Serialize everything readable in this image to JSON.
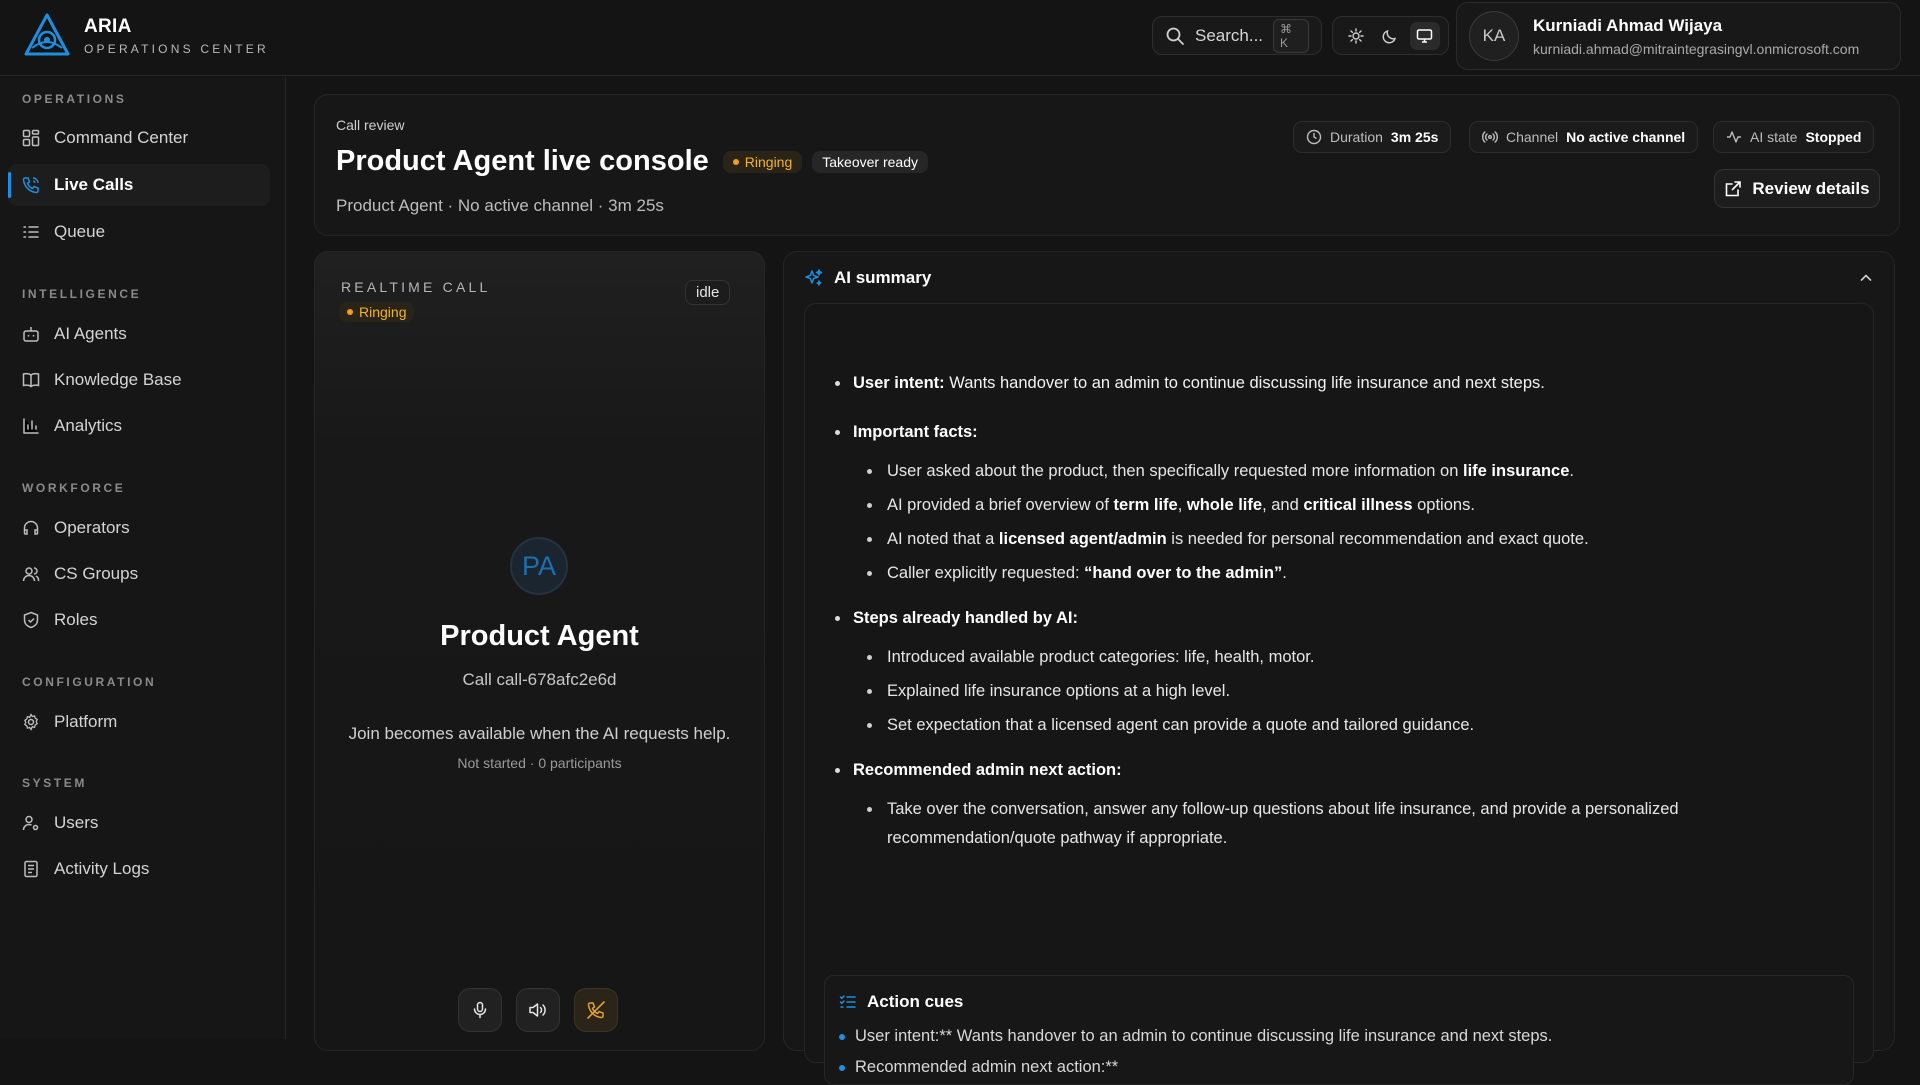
{
  "brand": {
    "title": "ARIA",
    "subtitle": "OPERATIONS CENTER",
    "accent": "#1d8fe0"
  },
  "search": {
    "label": "Search...",
    "shortcut": "⌘ K"
  },
  "theme_toggle": {
    "options": [
      "sun-icon",
      "moon-icon",
      "monitor-icon"
    ],
    "selected": "monitor-icon"
  },
  "user": {
    "initials": "KA",
    "name": "Kurniadi Ahmad Wijaya",
    "email": "kurniadi.ahmad@mitraintegrasingvl.onmicrosoft.com"
  },
  "sidebar": {
    "operations": {
      "title": "OPERATIONS",
      "items": [
        {
          "label": "Command Center",
          "icon": "grid-icon"
        },
        {
          "label": "Live Calls",
          "icon": "phone-icon",
          "active": true
        },
        {
          "label": "Queue",
          "icon": "list-icon"
        }
      ]
    },
    "intelligence": {
      "title": "INTELLIGENCE",
      "items": [
        {
          "label": "AI Agents",
          "icon": "bot-icon"
        },
        {
          "label": "Knowledge Base",
          "icon": "book-icon"
        },
        {
          "label": "Analytics",
          "icon": "bar-chart-icon"
        }
      ]
    },
    "workforce": {
      "title": "WORKFORCE",
      "items": [
        {
          "label": "Operators",
          "icon": "headset-icon"
        },
        {
          "label": "CS Groups",
          "icon": "users-icon"
        },
        {
          "label": "Roles",
          "icon": "shield-icon"
        }
      ]
    },
    "configuration": {
      "title": "CONFIGURATION",
      "items": [
        {
          "label": "Platform",
          "icon": "gear-icon"
        }
      ]
    },
    "system": {
      "title": "SYSTEM",
      "items": [
        {
          "label": "Users",
          "icon": "user-cog-icon"
        },
        {
          "label": "Activity Logs",
          "icon": "log-icon"
        }
      ]
    }
  },
  "header": {
    "eyebrow": "Call review",
    "title": "Product Agent live console",
    "status": "Ringing",
    "badge": "Takeover ready",
    "meta": "Product Agent · No active channel · 3m 25s",
    "duration": {
      "label": "Duration",
      "value": "3m 25s"
    },
    "channel": {
      "label": "Channel",
      "value": "No active channel"
    },
    "ai_state": {
      "label": "AI state",
      "value": "Stopped"
    },
    "review_button": "Review details"
  },
  "call_panel": {
    "title": "REALTIME CALL",
    "status": "Ringing",
    "idle": "idle",
    "initials": "PA",
    "agent_name": "Product Agent",
    "call_id": "Call call-678afc2e6d",
    "join_text": "Join becomes available when the AI requests help.",
    "participants": "Not started · 0 participants",
    "controls": [
      "microphone-icon",
      "speaker-icon",
      "phone-off-icon"
    ]
  },
  "summary": {
    "title": "AI summary",
    "user_intent": {
      "label": "User intent:",
      "text": " Wants handover to an admin to continue discussing life insurance and next steps."
    },
    "facts": {
      "label": "Important facts:",
      "f1": {
        "pre": "User asked about the product, then specifically requested more information on ",
        "b1": "life insurance",
        "post": "."
      },
      "f2": {
        "pre": "AI provided a brief overview of ",
        "b1": "term life",
        "mid1": ", ",
        "b2": "whole life",
        "mid2": ", and ",
        "b3": "critical illness",
        "post": " options."
      },
      "f3": {
        "pre": "AI noted that a ",
        "b1": "licensed agent/admin",
        "post": " is needed for personal recommendation and exact quote."
      },
      "f4": {
        "pre": "Caller explicitly requested: ",
        "b1": "“hand over to the admin”",
        "post": "."
      }
    },
    "handled": {
      "label": "Steps already handled by AI:",
      "items": [
        "Introduced available product categories: life, health, motor.",
        "Explained life insurance options at a high level.",
        "Set expectation that a licensed agent can provide a quote and tailored guidance."
      ]
    },
    "next_action": {
      "label": "Recommended admin next action:",
      "line1": "Take over the conversation, answer any follow-up questions about life insurance, and provide a personalized",
      "line2": "recommendation/quote pathway if appropriate."
    }
  },
  "action_cues": {
    "title": "Action cues",
    "items": [
      "User intent:** Wants handover to an admin to continue discussing life insurance and next steps.",
      "Recommended admin next action:**"
    ]
  }
}
